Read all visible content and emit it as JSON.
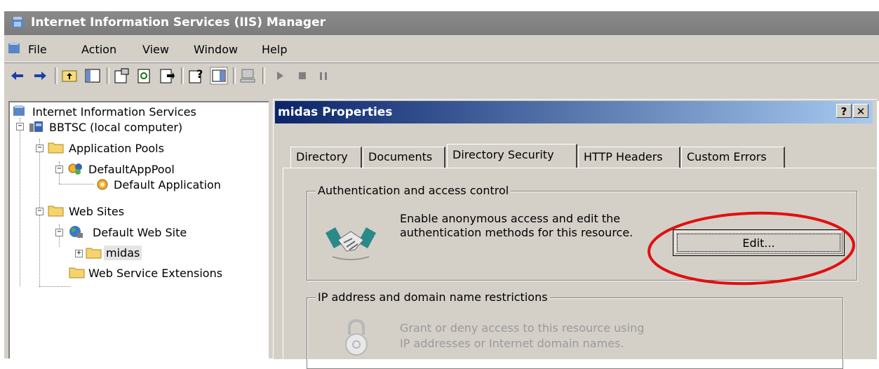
{
  "window": {
    "title": "Internet Information Services (IIS) Manager",
    "app_icon": "iis-icon"
  },
  "menu": {
    "items": [
      "File",
      "Action",
      "View",
      "Window",
      "Help"
    ]
  },
  "toolbar": {
    "buttons": [
      "back-icon",
      "forward-icon",
      "up-folder-icon",
      "show-hide-tree-icon",
      "properties-icon",
      "refresh-icon",
      "export-list-icon",
      "help-icon",
      "show-hide-action-pane-icon",
      "computer-icon",
      "play-icon",
      "stop-icon",
      "pause-icon"
    ]
  },
  "tree": {
    "root": "Internet Information Services",
    "computer": "BBTSC (local computer)",
    "app_pools": "Application Pools",
    "default_app_pool": "DefaultAppPool",
    "default_application": "Default Application",
    "web_sites": "Web Sites",
    "default_web_site": "Default Web Site",
    "selected": "midas",
    "web_service_extensions": "Web Service Extensions"
  },
  "dialog": {
    "title": "midas Properties",
    "help_button": "?",
    "close_button": "✕",
    "tabs": [
      "Directory",
      "Documents",
      "Directory Security",
      "HTTP Headers",
      "Custom Errors"
    ],
    "active_tab": "Directory Security",
    "auth_group": {
      "label": "Authentication and access control",
      "line1": "Enable anonymous access and edit the",
      "line2": "authentication methods for this resource.",
      "button": "Edit...",
      "icon": "handshake-icon"
    },
    "ip_group": {
      "label": "IP address and domain name restrictions",
      "line1": "Grant or deny access to this resource using",
      "line2": "IP addresses or Internet domain names.",
      "icon": "lock-icon"
    }
  },
  "annotation": {
    "highlight_color": "#e01010"
  }
}
